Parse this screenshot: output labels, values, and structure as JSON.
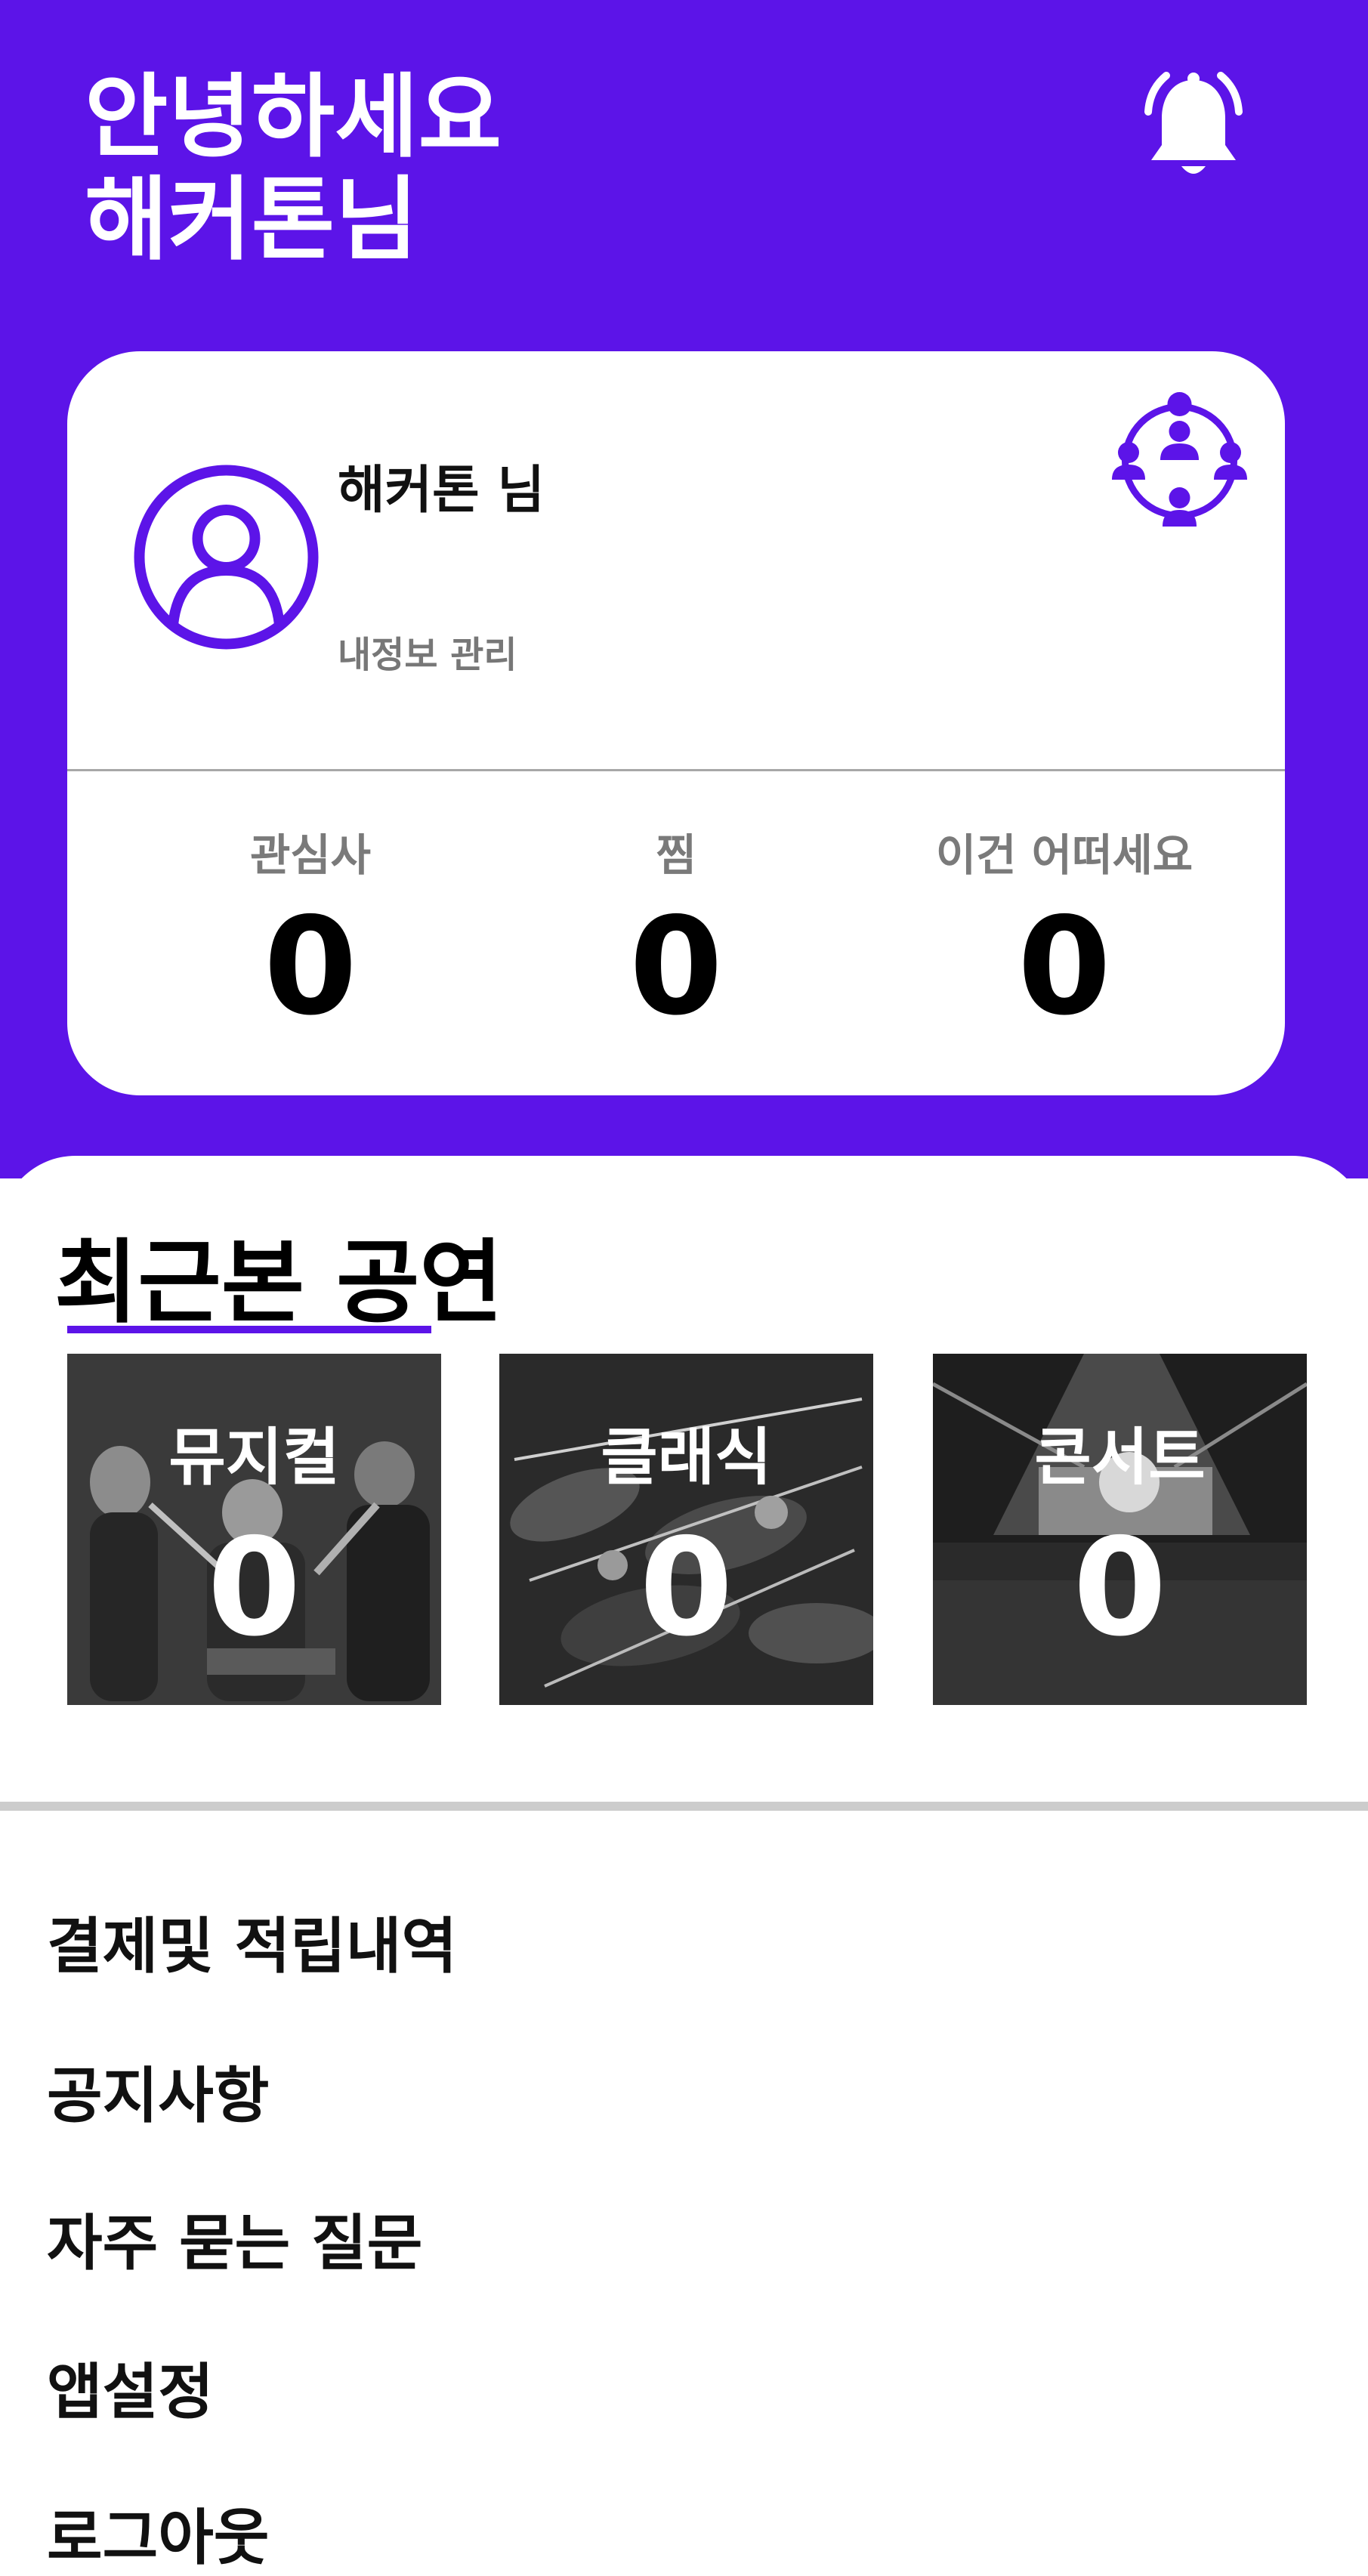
{
  "header": {
    "greeting_line1": "안녕하세요",
    "greeting_line2": "해커톤님",
    "bell_icon": "bell-icon",
    "background_color": "#5c14e8"
  },
  "profile": {
    "name": "해커톤 님",
    "manage_label": "내정보 관리",
    "avatar_icon": "user-avatar-icon",
    "group_icon": "group-network-icon"
  },
  "stats": [
    {
      "label": "관심사",
      "value": "0"
    },
    {
      "label": "찜",
      "value": "0"
    },
    {
      "label": "이건 어떠세요",
      "value": "0"
    }
  ],
  "recent": {
    "title": "최근본 공연",
    "accent_color": "#5c14e8",
    "categories": [
      {
        "label": "뮤지컬",
        "count": "0"
      },
      {
        "label": "클래식",
        "count": "0"
      },
      {
        "label": "콘서트",
        "count": "0"
      }
    ]
  },
  "menu": [
    {
      "label": "결제및 적립내역"
    },
    {
      "label": "공지사항"
    },
    {
      "label": "자주 묻는 질문"
    },
    {
      "label": "앱설정"
    },
    {
      "label": "로그아웃"
    }
  ]
}
